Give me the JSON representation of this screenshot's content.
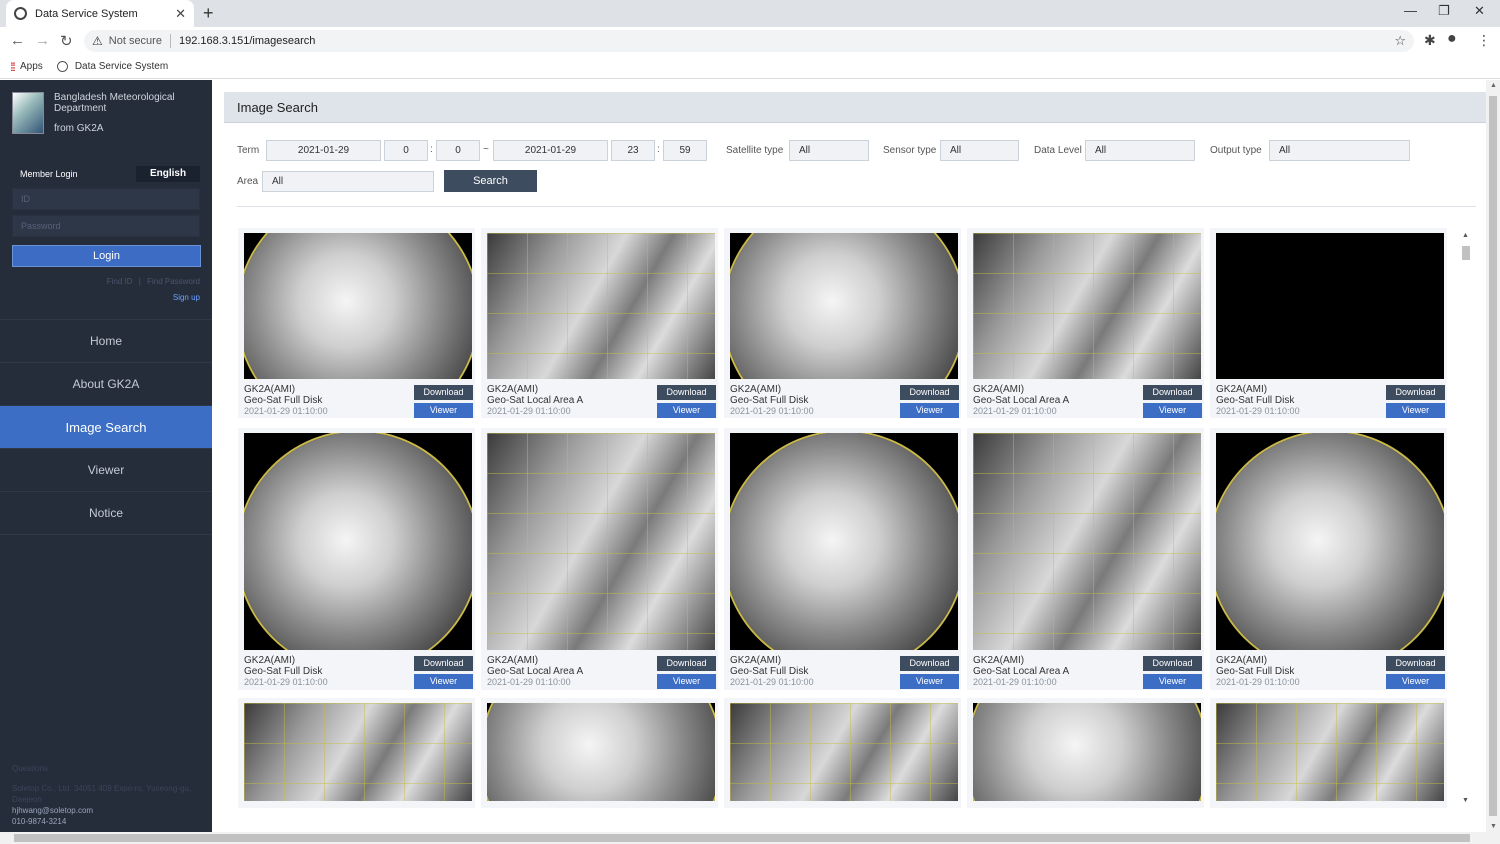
{
  "browser": {
    "tab_title": "Data Service System",
    "tab_close": "✕",
    "new_tab": "+",
    "not_secure": "Not secure",
    "url": "192.168.3.151/imagesearch",
    "bookmarks": {
      "apps": "Apps",
      "site": "Data Service System"
    },
    "window_controls": {
      "minimize": "—",
      "maximize": "❐",
      "close": "✕"
    }
  },
  "sidebar": {
    "org_name": "Bangladesh Meteorological Department",
    "org_from": "from GK2A",
    "member_login": "Member Login",
    "language": "English",
    "id_placeholder": "ID",
    "password_placeholder": "Password",
    "login": "Login",
    "find_id": "Find ID",
    "find_separator": "|",
    "find_password": "Find Password",
    "sign_up": "Sign up",
    "menu": [
      {
        "label": "Home",
        "active": false
      },
      {
        "label": "About GK2A",
        "active": false
      },
      {
        "label": "Image Search",
        "active": true
      },
      {
        "label": "Viewer",
        "active": false
      },
      {
        "label": "Notice",
        "active": false
      }
    ],
    "footer": {
      "questions": "Questions",
      "company": "Soletop Co., Ltd. 34051 409 Expo-ro, Yuseong-gu, Daejeon",
      "email": "hjhwang@soletop.com",
      "phone": "010-9874-3214"
    }
  },
  "main": {
    "title": "Image Search",
    "filters": {
      "term_label": "Term",
      "start_date": "2021-01-29",
      "start_hour": "0",
      "start_min": "0",
      "range_sep": "~",
      "end_date": "2021-01-29",
      "end_hour": "23",
      "end_min": "59",
      "time_sep": ":",
      "satellite_label": "Satellite type",
      "satellite_value": "All",
      "sensor_label": "Sensor type",
      "sensor_value": "All",
      "level_label": "Data Level",
      "level_value": "All",
      "output_label": "Output type",
      "output_value": "All",
      "area_label": "Area",
      "area_value": "All",
      "search": "Search"
    },
    "cards": [
      {
        "satellite": "GK2A(AMI)",
        "type": "Geo-Sat Full Disk",
        "time": "2021-01-29 01:10:00",
        "style": "disk"
      },
      {
        "satellite": "GK2A(AMI)",
        "type": "Geo-Sat Local Area A",
        "time": "2021-01-29 01:10:00",
        "style": "local"
      },
      {
        "satellite": "GK2A(AMI)",
        "type": "Geo-Sat Full Disk",
        "time": "2021-01-29 01:10:00",
        "style": "disk"
      },
      {
        "satellite": "GK2A(AMI)",
        "type": "Geo-Sat Local Area A",
        "time": "2021-01-29 01:10:00",
        "style": "local"
      },
      {
        "satellite": "GK2A(AMI)",
        "type": "Geo-Sat Full Disk",
        "time": "2021-01-29 01:10:00",
        "style": "black"
      },
      {
        "satellite": "GK2A(AMI)",
        "type": "Geo-Sat Full Disk",
        "time": "2021-01-29 01:10:00",
        "style": "disk"
      },
      {
        "satellite": "GK2A(AMI)",
        "type": "Geo-Sat Local Area A",
        "time": "2021-01-29 01:10:00",
        "style": "local"
      },
      {
        "satellite": "GK2A(AMI)",
        "type": "Geo-Sat Full Disk",
        "time": "2021-01-29 01:10:00",
        "style": "disk"
      },
      {
        "satellite": "GK2A(AMI)",
        "type": "Geo-Sat Local Area A",
        "time": "2021-01-29 01:10:00",
        "style": "local"
      },
      {
        "satellite": "GK2A(AMI)",
        "type": "Geo-Sat Full Disk",
        "time": "2021-01-29 01:10:00",
        "style": "disk"
      },
      {
        "style": "local"
      },
      {
        "style": "disk"
      },
      {
        "style": "local"
      },
      {
        "style": "disk"
      },
      {
        "style": "local"
      }
    ],
    "download_label": "Download",
    "viewer_label": "Viewer"
  },
  "colors": {
    "sidebar_bg": "#252d3b",
    "accent_blue": "#3d6ec6",
    "dark_button": "#3e4c5f"
  }
}
